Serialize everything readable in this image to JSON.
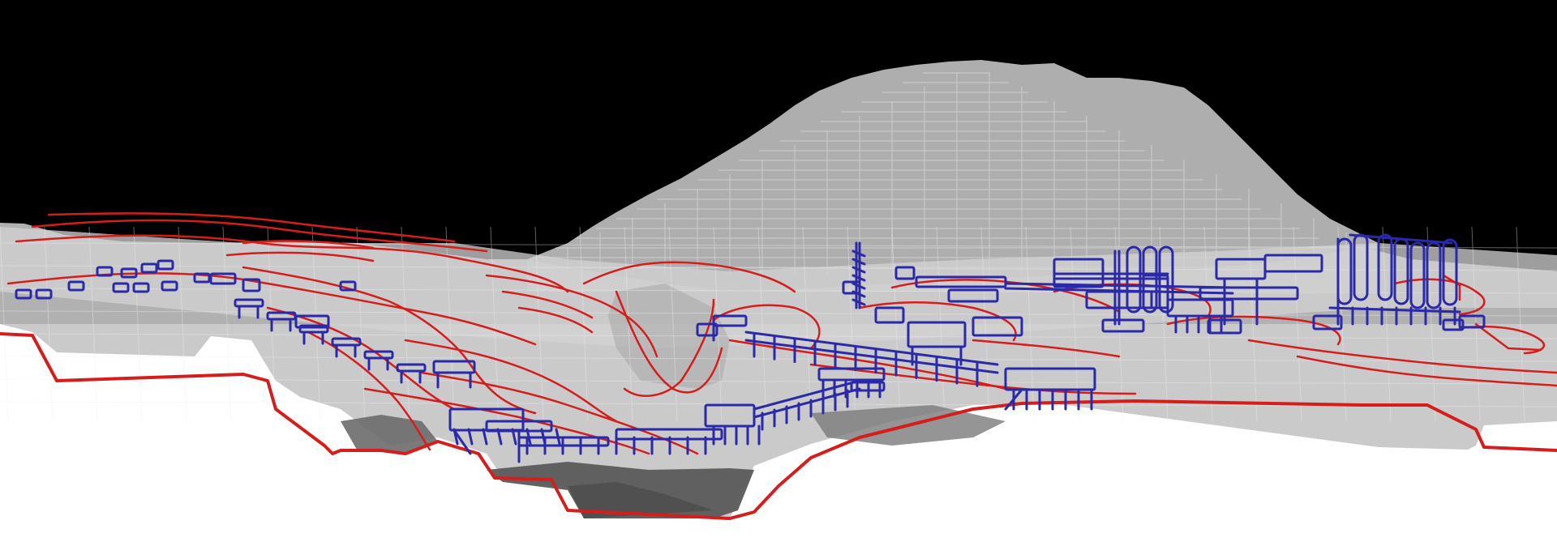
{
  "colors": {
    "sky": "#000000",
    "ground": "#ffffff",
    "massing": "#c9c9c9",
    "massing_dark": "#8a8a8a",
    "pit": "#5a5a5a",
    "contour": "#d41e1e",
    "structure": "#2a2aa8",
    "wireframe": "#eeeeee"
  },
  "layers": [
    "sky",
    "mountain-massing",
    "ground-massing",
    "pit-shading",
    "section-cut-line",
    "contour-lines",
    "blue-structures"
  ]
}
